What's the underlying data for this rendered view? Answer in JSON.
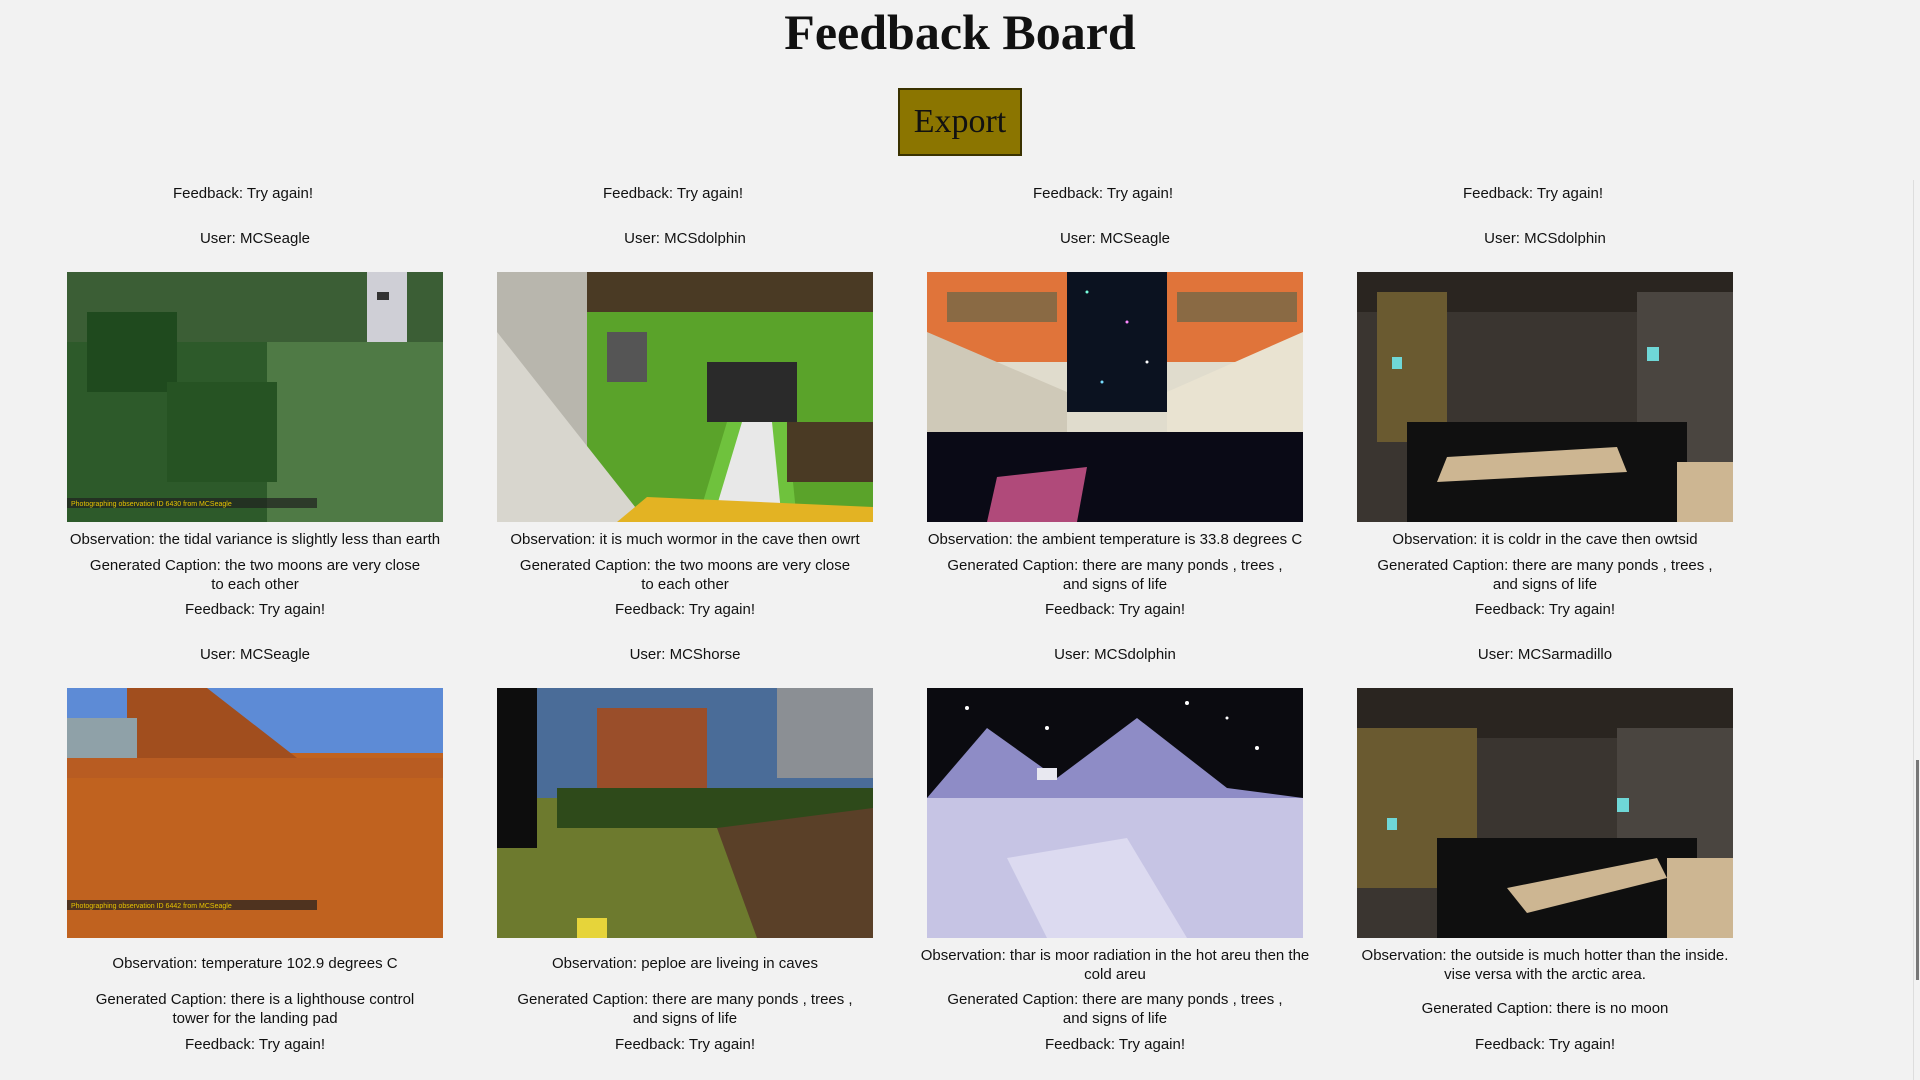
{
  "header": {
    "title": "Feedback Board",
    "export_label": "Export"
  },
  "top_feedback": [
    "Feedback: Try again!",
    "Feedback: Try again!",
    "Feedback: Try again!",
    "Feedback: Try again!"
  ],
  "rows": [
    [
      {
        "user": "User: MCSeagle",
        "observation": "Observation: the tidal variance is slightly less than earth",
        "caption": "Generated Caption: the two moons are very close to each other",
        "feedback": "Feedback: Try again!",
        "overlay": "Photographing observation ID 6430 from MCSeagle",
        "scene": "forest"
      },
      {
        "user": "User: MCSdolphin",
        "observation": "Observation: it is much wormor in the cave then owrt",
        "caption": "Generated Caption: the two moons are very close to each other",
        "feedback": "Feedback: Try again!",
        "scene": "stairs"
      },
      {
        "user": "User: MCSeagle",
        "observation": "Observation: the ambient temperature is 33.8 degrees C",
        "caption": "Generated Caption: there are many ponds , trees , and signs of life",
        "feedback": "Feedback: Try again!",
        "scene": "space-window"
      },
      {
        "user": "User: MCSdolphin",
        "observation": "Observation: it is coldr in the cave then owtsid",
        "caption": "Generated Caption: there are many ponds , trees , and signs of life",
        "feedback": "Feedback: Try again!",
        "scene": "cave"
      }
    ],
    [
      {
        "user": "User: MCSeagle",
        "observation": "Observation: temperature 102.9 degrees C",
        "caption": "Generated Caption: there is a lighthouse control tower for the landing pad",
        "feedback": "Feedback: Try again!",
        "overlay": "Photographing observation ID 6442 from MCSeagle",
        "scene": "desert"
      },
      {
        "user": "User: MCShorse",
        "observation": "Observation: peploe are liveing in caves",
        "caption": "Generated Caption: there are many ponds , trees , and signs of life",
        "feedback": "Feedback: Try again!",
        "scene": "grassland"
      },
      {
        "user": "User: MCSdolphin",
        "observation": "Observation: thar is moor radiation in the hot areu then the cold areu",
        "caption": "Generated Caption: there are many ponds , trees , and signs of life",
        "feedback": "Feedback: Try again!",
        "scene": "snow"
      },
      {
        "user": "User: MCSarmadillo",
        "observation": "Observation: the outside is much hotter than the inside. vise versa with the arctic area.",
        "caption": "Generated Caption: there is no moon",
        "feedback": "Feedback: Try again!",
        "scene": "cave2"
      }
    ]
  ],
  "colors": {
    "export_bg": "#8b7500",
    "page_bg": "#f2f2f2"
  }
}
